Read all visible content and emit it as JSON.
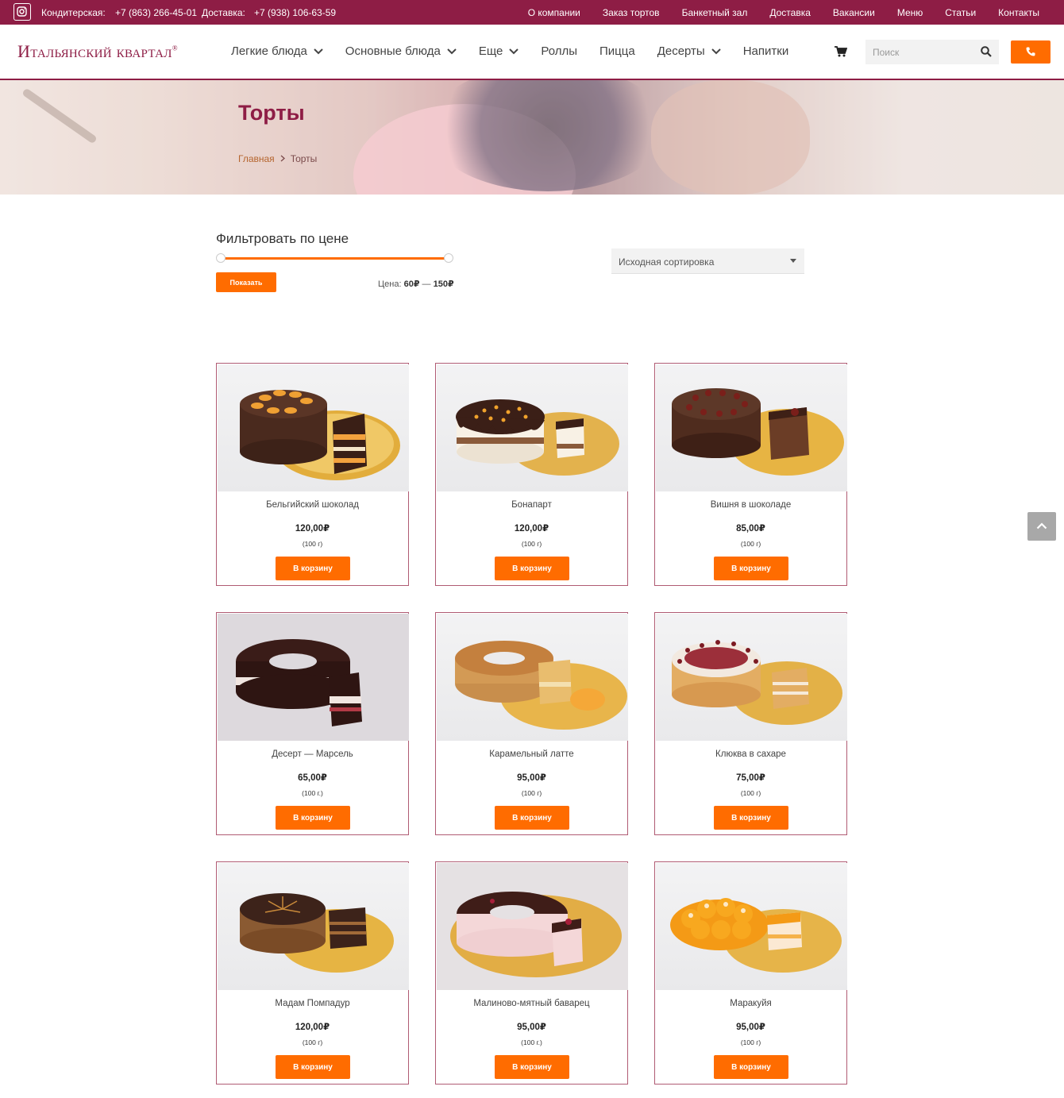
{
  "topbar": {
    "confectionery_label": "Кондитерская:",
    "confectionery_phone": "+7 (863) 266-45-01",
    "delivery_label": "Доставка:",
    "delivery_phone": "+7 (938) 106-63-59",
    "links": [
      "О компании",
      "Заказ тортов",
      "Банкетный зал",
      "Доставка",
      "Вакансии",
      "Меню",
      "Статьи",
      "Контакты"
    ]
  },
  "header": {
    "logo": "Итальянский квартал",
    "logo_mark": "®",
    "nav": [
      {
        "label": "Легкие блюда",
        "dropdown": true
      },
      {
        "label": "Основные блюда",
        "dropdown": true
      },
      {
        "label": "Еще",
        "dropdown": true
      },
      {
        "label": "Роллы",
        "dropdown": false
      },
      {
        "label": "Пицца",
        "dropdown": false
      },
      {
        "label": "Десерты",
        "dropdown": true
      },
      {
        "label": "Напитки",
        "dropdown": false
      }
    ],
    "search_placeholder": "Поиск",
    "icons": {
      "cart": "cart-icon",
      "search": "search-icon",
      "call": "phone-icon"
    }
  },
  "hero": {
    "title": "Торты",
    "breadcrumb_home": "Главная",
    "breadcrumb_current": "Торты"
  },
  "filter": {
    "title": "Фильтровать по цене",
    "button": "Показать",
    "price_label": "Цена:",
    "price_min": "60₽",
    "price_dash": "—",
    "price_max": "150₽"
  },
  "sort": {
    "selected": "Исходная сортировка"
  },
  "colors": {
    "brand": "#8e1d45",
    "accent": "#ff6c00"
  },
  "products": [
    {
      "name": "Бельгийский шоколад",
      "price": "120,00₽",
      "weight": "(100 г)",
      "button": "В корзину"
    },
    {
      "name": "Бонапарт",
      "price": "120,00₽",
      "weight": "(100 г)",
      "button": "В корзину"
    },
    {
      "name": "Вишня в шоколаде",
      "price": "85,00₽",
      "weight": "(100 г)",
      "button": "В корзину"
    },
    {
      "name": "Десерт — Марсель",
      "price": "65,00₽",
      "weight": "(100 г.)",
      "button": "В корзину"
    },
    {
      "name": "Карамельный латте",
      "price": "95,00₽",
      "weight": "(100 г)",
      "button": "В корзину"
    },
    {
      "name": "Клюква в сахаре",
      "price": "75,00₽",
      "weight": "(100 г)",
      "button": "В корзину"
    },
    {
      "name": "Мадам Помпадур",
      "price": "120,00₽",
      "weight": "(100 г)",
      "button": "В корзину"
    },
    {
      "name": "Малиново-мятный баварец",
      "price": "95,00₽",
      "weight": "(100 г.)",
      "button": "В корзину"
    },
    {
      "name": "Маракуйя",
      "price": "95,00₽",
      "weight": "(100 г)",
      "button": "В корзину"
    }
  ]
}
